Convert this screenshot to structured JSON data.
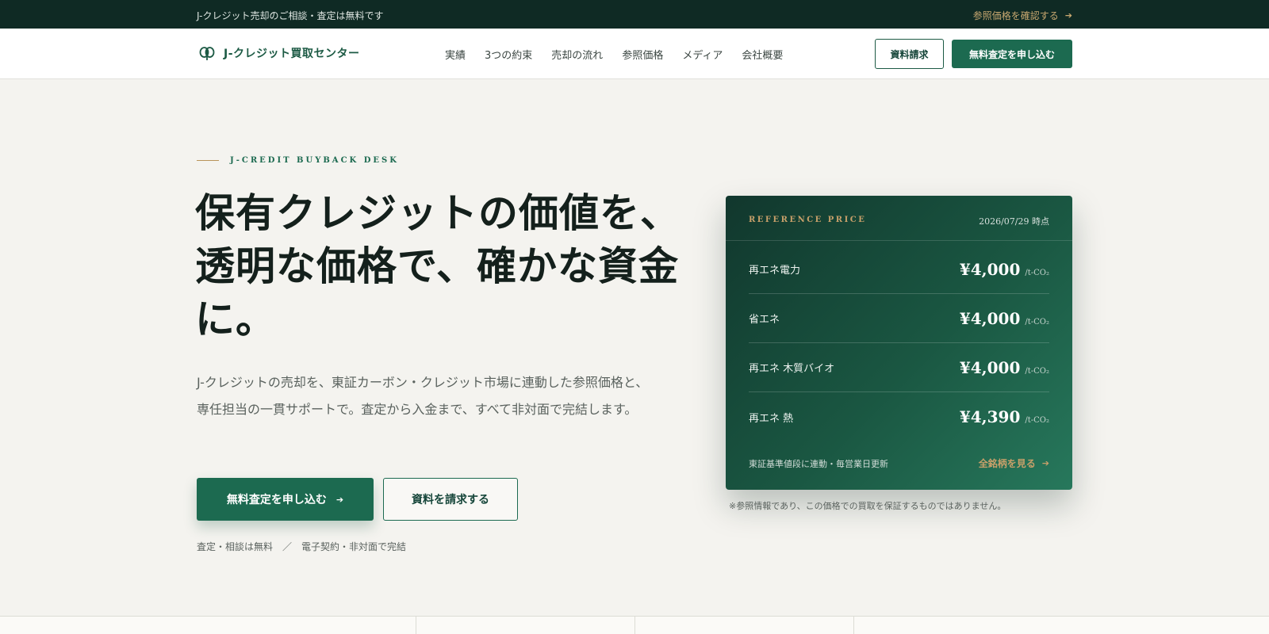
{
  "topbar": {
    "notice": "J-クレジット売却のご相談・査定は無料です",
    "link_label": "参照価格を確認する",
    "link_icon": "arrow-right-icon"
  },
  "header": {
    "logo_text": "J-クレジット買取センター",
    "nav": [
      "実績",
      "3つの約束",
      "売却の流れ",
      "参照価格",
      "メディア",
      "会社概要"
    ],
    "request_docs_label": "資料請求",
    "apply_label": "無料査定を申し込む"
  },
  "hero": {
    "eyebrow": "J-CREDIT BUYBACK DESK",
    "title": "保有クレジットの価値を、透明な価格で、確かな資金に。",
    "description": "J-クレジットの売却を、東証カーボン・クレジット市場に連動した参照価格と、 専任担当の一貫サポートで。査定から入金まで、すべて非対面で完結します。",
    "primary_label": "無料査定を申し込む",
    "secondary_label": "資料を請求する",
    "note": "査定・相談は無料　／　電子契約・非対面で完結"
  },
  "price_card": {
    "label": "REFERENCE PRICE",
    "date": "2026/07/29 時点",
    "unit": "/t-CO₂",
    "rows": [
      {
        "name": "再エネ電力",
        "price": "¥4,000"
      },
      {
        "name": "省エネ",
        "price": "¥4,000"
      },
      {
        "name": "再エネ 木質バイオ",
        "price": "¥4,000"
      },
      {
        "name": "再エネ 熱",
        "price": "¥4,390"
      }
    ],
    "foot_note": "東証基準値段に連動・毎営業日更新",
    "foot_link": "全銘柄を見る"
  },
  "disclaimer": "※参照情報であり、この価格での買取を保証するものではありません。",
  "colors": {
    "brand": "#1c6a50",
    "dark": "#0f2a24",
    "gold": "#c8a06a",
    "background": "#f4f3ef"
  }
}
